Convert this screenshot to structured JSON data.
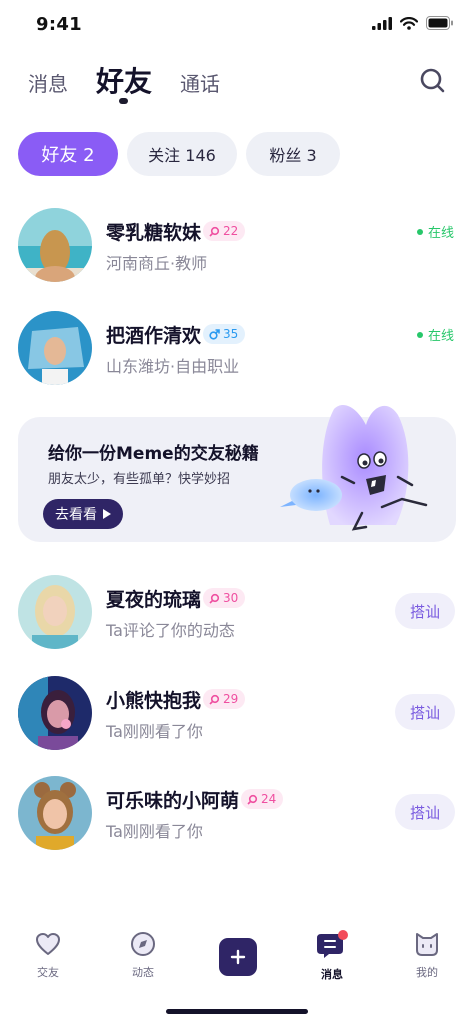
{
  "status_bar": {
    "time": "9:41"
  },
  "top_tabs": [
    {
      "label": "消息"
    },
    {
      "label": "好友"
    },
    {
      "label": "通话"
    }
  ],
  "pills": [
    {
      "label": "好友 2"
    },
    {
      "label": "关注 146"
    },
    {
      "label": "粉丝 3"
    }
  ],
  "friends": [
    {
      "name": "零乳糖软妹",
      "badge": "22",
      "badge_type": "female",
      "sub": "河南商丘·教师",
      "status": "在线"
    },
    {
      "name": "把酒作清欢",
      "badge": "35",
      "badge_type": "male",
      "sub": "山东潍坊·自由职业",
      "status": "在线"
    }
  ],
  "promo": {
    "title": "给你一份Meme的交友秘籍",
    "subtitle": "朋友太少，有些孤单？快学妙招",
    "button": "去看看"
  },
  "contacts": [
    {
      "name": "夏夜的琉璃",
      "badge": "30",
      "badge_type": "female",
      "sub": "Ta评论了你的动态",
      "action": "搭讪"
    },
    {
      "name": "小熊快抱我",
      "badge": "29",
      "badge_type": "female",
      "sub": "Ta刚刚看了你",
      "action": "搭讪"
    },
    {
      "name": "可乐味的小阿萌",
      "badge": "24",
      "badge_type": "female",
      "sub": "Ta刚刚看了你",
      "action": "搭讪"
    }
  ],
  "tabbar": [
    {
      "label": "交友",
      "icon": "heart-icon"
    },
    {
      "label": "动态",
      "icon": "compass-icon"
    },
    {
      "label": "",
      "icon": "plus-icon"
    },
    {
      "label": "消息",
      "icon": "message-icon",
      "has_dot": true
    },
    {
      "label": "我的",
      "icon": "cat-face-icon"
    }
  ],
  "colors": {
    "accent": "#8a5cf5",
    "primary_dark": "#2f2566",
    "online": "#27c76a",
    "female_badge": "#ef4fa0",
    "male_badge": "#2a9af0",
    "notification": "#f24b5a"
  }
}
